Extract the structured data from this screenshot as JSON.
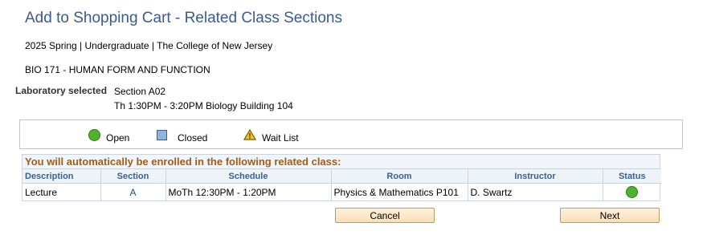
{
  "page": {
    "title": "Add to Shopping Cart - Related Class Sections",
    "term": "2025 Spring | Undergraduate | The College of New Jersey",
    "course": "BIO  171 - HUMAN FORM AND FUNCTION"
  },
  "laboratory": {
    "label": "Laboratory selected",
    "section": "Section A02",
    "time_location": "Th 1:30PM - 3:20PM   Biology Building 104"
  },
  "legend": {
    "items": [
      {
        "label": "Open",
        "icon": "open-circle-icon",
        "color": "#4fb22e"
      },
      {
        "label": "Closed",
        "icon": "closed-square-icon",
        "color": "#8fb5df"
      },
      {
        "label": "Wait List",
        "icon": "wait-list-triangle-icon",
        "color": "#f2c12e"
      }
    ]
  },
  "related": {
    "title": "You will automatically be enrolled in the following related class:",
    "title_color": "#a35c14",
    "columns": [
      "Description",
      "Section",
      "Schedule",
      "Room",
      "Instructor",
      "Status"
    ],
    "rows": [
      {
        "description": "Lecture",
        "section": "A",
        "schedule": "MoTh 12:30PM - 1:20PM",
        "room": "Physics & Mathematics  P101",
        "instructor": "D. Swartz",
        "status": "Open",
        "status_icon": "open-circle-icon"
      }
    ]
  },
  "buttons": {
    "cancel": "Cancel",
    "next": "Next"
  }
}
